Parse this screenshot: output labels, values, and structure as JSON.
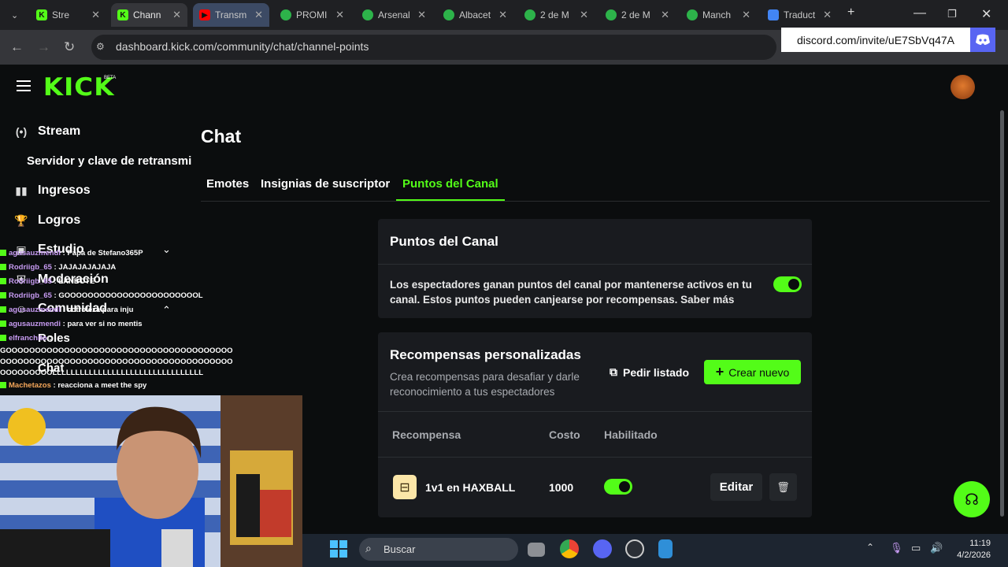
{
  "browser": {
    "tabs": [
      {
        "title": "Stre",
        "favicon": "kick-icon",
        "active": false
      },
      {
        "title": "Chann",
        "favicon": "kick-icon",
        "active": true
      },
      {
        "title": "Transm",
        "favicon": "youtube-icon",
        "active": false
      },
      {
        "title": "PROMI",
        "favicon": "soccer-icon",
        "active": false
      },
      {
        "title": "Arsenal",
        "favicon": "soccer-icon",
        "active": false
      },
      {
        "title": "Albacet",
        "favicon": "soccer-icon",
        "active": false
      },
      {
        "title": "2 de M",
        "favicon": "soccer-icon",
        "active": false
      },
      {
        "title": "2 de M",
        "favicon": "soccer-icon",
        "active": false
      },
      {
        "title": "Manch",
        "favicon": "soccer-icon",
        "active": false
      },
      {
        "title": "Traduct",
        "favicon": "translate-icon",
        "active": false
      }
    ],
    "url": "dashboard.kick.com/community/chat/channel-points"
  },
  "discord_banner": {
    "text": "discord.com/invite/uE7SbVq47A"
  },
  "brand": {
    "logo": "KICK",
    "badge": "BETA",
    "accent": "#53fc18"
  },
  "sidebar": {
    "items": [
      {
        "label": "Stream",
        "icon": "broadcast-icon"
      },
      {
        "label": "Servidor y clave de retransmi",
        "icon": ""
      },
      {
        "label": "Ingresos",
        "icon": "chart-icon"
      },
      {
        "label": "Logros",
        "icon": "trophy-icon"
      },
      {
        "label": "Estudio",
        "icon": "studio-icon"
      },
      {
        "label": "Moderación",
        "icon": "shield-icon"
      },
      {
        "label": "Comunidad",
        "icon": "community-icon"
      },
      {
        "label": "Roles",
        "icon": ""
      },
      {
        "label": "Chat",
        "icon": ""
      }
    ]
  },
  "main": {
    "title": "Chat",
    "tabs": [
      "Emotes",
      "Insignias de suscriptor",
      "Puntos del Canal"
    ],
    "active_tab": "Puntos del Canal",
    "channel_points": {
      "heading": "Puntos del Canal",
      "description": "Los espectadores ganan puntos del canal por mantenerse activos en tu canal. Estos puntos pueden canjearse por recompensas. Saber más",
      "enabled": true
    },
    "rewards": {
      "heading": "Recompensas personalizadas",
      "description": "Crea recompensas para desafiar y darle reconocimiento a tus espectadores",
      "pedir_label": "Pedir listado",
      "crear_label": "Crear nuevo",
      "columns": [
        "Recompensa",
        "Costo",
        "Habilitado"
      ],
      "rows": [
        {
          "name": "1v1 en HAXBALL",
          "cost": "1000",
          "enabled": true,
          "edit_label": "Editar"
        }
      ]
    }
  },
  "stream_chat": [
    {
      "user": "agusauzmendi",
      "user_color": "#c79bf2",
      "message": "Papa de Stefano365P"
    },
    {
      "user": "Rodriigb_65",
      "user_color": "#c79bf2",
      "message": "JAJAJAJAJAJA"
    },
    {
      "user": "Rodriigb_65",
      "user_color": "#c79bf2",
      "message": "LANBOTE"
    },
    {
      "user": "Rodriigb_65",
      "user_color": "#c79bf2",
      "message": "GOOOOOOOOOOOOOOOOOOOOOOOL"
    },
    {
      "user": "agusauzmendi",
      "user_color": "#c79bf2",
      "message": "cotroleza para inju"
    },
    {
      "user": "agusauzmendi",
      "user_color": "#c79bf2",
      "message": "para ver si no mentis"
    },
    {
      "user": "elfranchito",
      "user_color": "#c79bf2",
      "message": ""
    }
  ],
  "stream_spam": [
    "GOOOOOOOOOOOOOOOOOOOOOOOOOOOOOOOOOOOOOOO",
    "OOOOOOOOOOOOOOOOOOOOOOOOOOOOOOOOOOOOOOOO",
    "OOOOOOOOOLLLLLLLLLLLLLLLLLLLLLLLLLLLLLLLLL"
  ],
  "stream_last": {
    "user": "Machetazos",
    "user_color": "#f6a75a",
    "message": "reacciona a meet the spy"
  },
  "taskbar": {
    "search_placeholder": "Buscar",
    "time": "11:19",
    "date": "4/2/2026"
  }
}
